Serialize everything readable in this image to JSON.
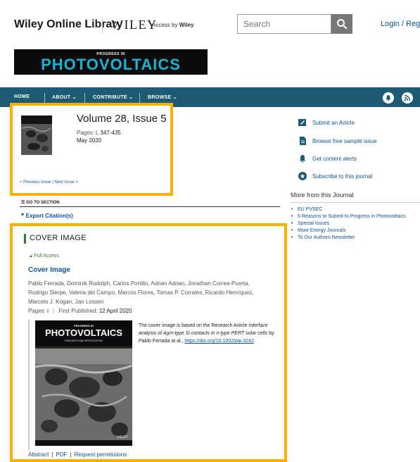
{
  "header": {
    "site_name": "Wiley Online Library",
    "publisher": "WILEY",
    "access_by_prefix": "Access by",
    "access_by_org": "Wiley",
    "search_placeholder": "Search",
    "login_label": "Login / Register"
  },
  "banner": {
    "small": "PROGRESS IN",
    "big": "PHOTOVOLTAICS"
  },
  "nav": {
    "items": [
      "HOME",
      "ABOUT",
      "CONTRIBUTE",
      "BROWSE"
    ],
    "chevron": "⌄"
  },
  "issue": {
    "title": "Volume 28, Issue 5",
    "pages_label": "Pages:",
    "pages_value": "i, 347-435",
    "date": "May 2020",
    "prev_next": "< Previous Issue  |  Next Issue >"
  },
  "goto_section": "GO TO SECTION",
  "export_citation": "Export Citation(s)",
  "cover_section": {
    "heading": "COVER IMAGE",
    "access": "Full Access",
    "article_title": "Cover Image",
    "authors": "Pablo Ferrada,  Dominik Rudolph,  Carlos Portillo,  Adrian Adrian,  Jonathan Correa-Puerta,  Rodrigo Sierpe,  Valeria del Campo,  Marcos Flores,  Tomas P. Corrales,  Ricardo Henríquez,  Marcelo J. Kogan,  Jan Lossen",
    "pages_label": "Pages:",
    "pages_value": "i",
    "first_published_label": "First Published:",
    "first_published_value": "12 April 2020",
    "desc_prefix": "The cover image is based on the Research Article",
    "desc_italic": "Interface analysis of Ag/n-type Si contacts in n-type PERT solar cells",
    "desc_suffix": "by Pablo Ferrada at al.,",
    "doi": "https://doi.org/10.1002/pip.3242",
    "cover_small": "PROGRESS IN",
    "cover_big": "PHOTOVOLTAICS",
    "cover_sub": "RESEARCH AND APPLICATIONS",
    "cover_wiley": "WILEY",
    "links": [
      "Abstract",
      "PDF",
      "Request permissions"
    ]
  },
  "sidebar": {
    "actions": [
      {
        "label": "Submit an Article",
        "icon": "pencil-icon"
      },
      {
        "label": "Browse free sample issue",
        "icon": "document-icon"
      },
      {
        "label": "Get content alerts",
        "icon": "bell-icon"
      },
      {
        "label": "Subscribe to this journal",
        "icon": "star-badge-icon"
      }
    ],
    "more_title": "More from this Journal",
    "more_links": [
      "EU PVSEC",
      "5 Reasons to Submit to Progress in Photovoltaics",
      "Special Issues",
      "More Energy Journals",
      "To Our Authors Newsletter"
    ]
  },
  "colors": {
    "nav_bg": "#1f5a75",
    "highlight_border": "#f9b000",
    "link": "#0b5394",
    "access_green": "#2e7d32",
    "banner_text": "#18b4d8"
  }
}
